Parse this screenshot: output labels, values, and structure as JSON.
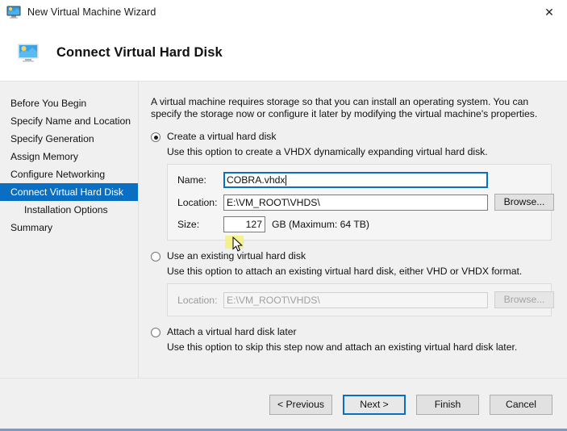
{
  "window": {
    "title": "New Virtual Machine Wizard",
    "icon": "virtual-machine-monitor-icon",
    "close_label": "✕"
  },
  "header": {
    "icon": "virtual-machine-monitor-icon",
    "title": "Connect Virtual Hard Disk"
  },
  "sidebar": {
    "items": [
      {
        "label": "Before You Begin",
        "selected": false,
        "sub": false
      },
      {
        "label": "Specify Name and Location",
        "selected": false,
        "sub": false
      },
      {
        "label": "Specify Generation",
        "selected": false,
        "sub": false
      },
      {
        "label": "Assign Memory",
        "selected": false,
        "sub": false
      },
      {
        "label": "Configure Networking",
        "selected": false,
        "sub": false
      },
      {
        "label": "Connect Virtual Hard Disk",
        "selected": true,
        "sub": false
      },
      {
        "label": "Installation Options",
        "selected": false,
        "sub": true
      },
      {
        "label": "Summary",
        "selected": false,
        "sub": false
      }
    ]
  },
  "content": {
    "intro": "A virtual machine requires storage so that you can install an operating system. You can specify the storage now or configure it later by modifying the virtual machine's properties.",
    "options": [
      {
        "id": "create-new",
        "label": "Create a virtual hard disk",
        "description": "Use this option to create a VHDX dynamically expanding virtual hard disk.",
        "checked": true
      },
      {
        "id": "use-existing",
        "label": "Use an existing virtual hard disk",
        "description": "Use this option to attach an existing virtual hard disk, either VHD or VHDX format.",
        "checked": false
      },
      {
        "id": "attach-later",
        "label": "Attach a virtual hard disk later",
        "description": "Use this option to skip this step now and attach an existing virtual hard disk later.",
        "checked": false
      }
    ],
    "create_fields": {
      "name_label": "Name:",
      "name_value": "COBRA.vhdx",
      "location_label": "Location:",
      "location_value": "E:\\VM_ROOT\\VHDS\\",
      "browse_label": "Browse...",
      "size_label": "Size:",
      "size_value": "127",
      "size_suffix": "GB (Maximum: 64 TB)"
    },
    "existing_fields": {
      "location_label": "Location:",
      "location_value": "E:\\VM_ROOT\\VHDS\\",
      "browse_label": "Browse..."
    }
  },
  "footer": {
    "previous_label": "< Previous",
    "next_label": "Next >",
    "finish_label": "Finish",
    "cancel_label": "Cancel"
  },
  "colors": {
    "accent": "#0a6fc2",
    "panel": "#f0f0f0",
    "highlight": "#f5f07a"
  }
}
